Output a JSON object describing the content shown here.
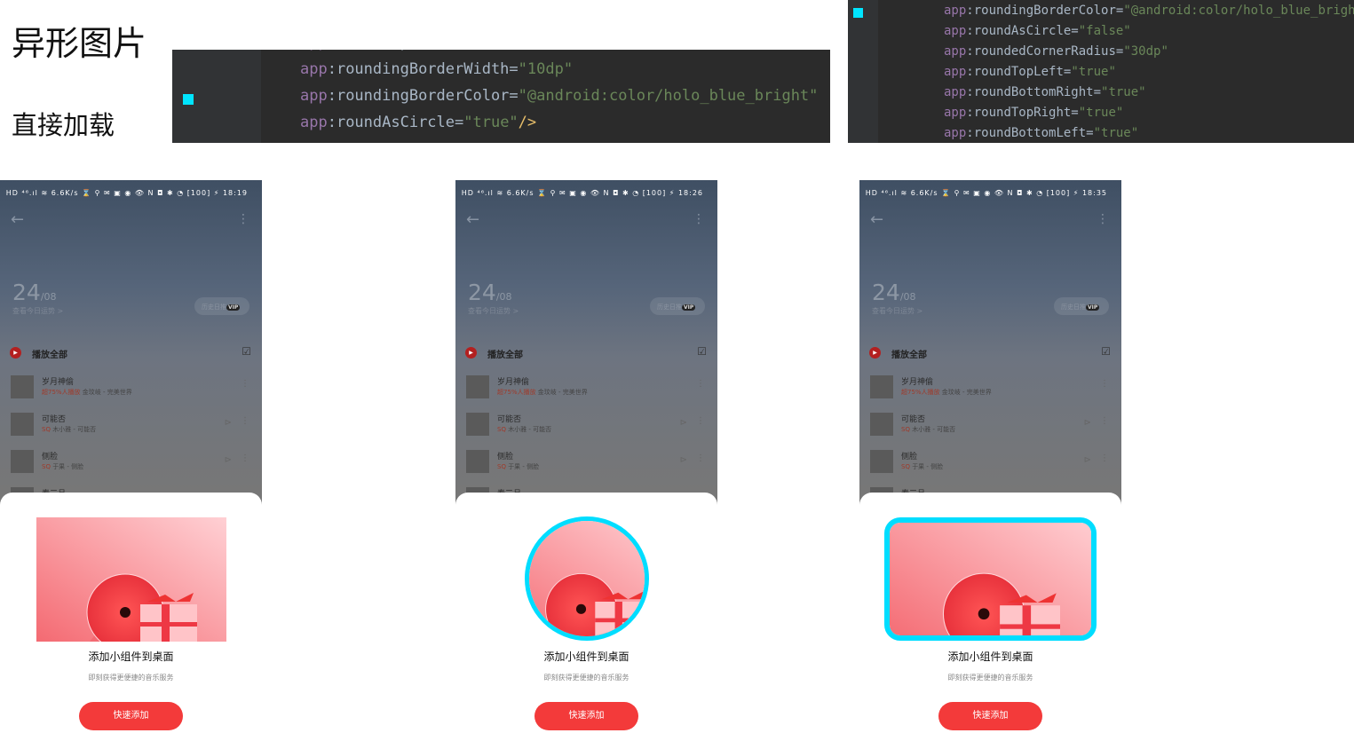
{
  "headings": {
    "title": "异形图片",
    "subtitle": "直接加载"
  },
  "code_left": {
    "lines": [
      {
        "k": "app",
        "a": ":roundTopLeft=",
        "v": "\"true\""
      },
      {
        "k": "app",
        "a": ":roundingBorderWidth=",
        "v": "\"10dp\""
      },
      {
        "k": "app",
        "a": ":roundingBorderColor=",
        "v": "\"@android:color/holo_blue_bright\""
      },
      {
        "k": "app",
        "a": ":roundAsCircle=",
        "v": "\"true\"",
        "end": "/>"
      }
    ]
  },
  "code_right": {
    "lines": [
      {
        "k": "app",
        "a": ":roundingBorderColor=",
        "v": "\"@android:color/holo_blue_bright\""
      },
      {
        "k": "app",
        "a": ":roundAsCircle=",
        "v": "\"false\""
      },
      {
        "k": "app",
        "a": ":roundedCornerRadius=",
        "v": "\"30dp\""
      },
      {
        "k": "app",
        "a": ":roundTopLeft=",
        "v": "\"true\""
      },
      {
        "k": "app",
        "a": ":roundBottomRight=",
        "v": "\"true\""
      },
      {
        "k": "app",
        "a": ":roundTopRight=",
        "v": "\"true\""
      },
      {
        "k": "app",
        "a": ":roundBottomLeft=",
        "v": "\"true\""
      }
    ]
  },
  "colors": {
    "border": "#00ddff",
    "button": "#f33a3a",
    "editor_bg": "#2b2b2b"
  },
  "phones": [
    {
      "time": "18:19",
      "shape": "rect"
    },
    {
      "time": "18:26",
      "shape": "circle"
    },
    {
      "time": "18:35",
      "shape": "rounded"
    }
  ],
  "phone": {
    "status_icons": "HD ⁴⁶.ıl ≋ 6.6K/s ⌛ ⚲ ✉ ▣ ◉  👁 N ◘ ✱ ◔ [100] ⚡",
    "date_day": "24",
    "date_month": "/08",
    "fortune": "查看今日运势 >",
    "history": "历史日推",
    "vip": "VIP",
    "play_all": "播放全部",
    "songs": [
      {
        "title": "岁月神偷",
        "tag": "超75%人播放",
        "sub": "金玟岐 - 完美世界"
      },
      {
        "title": "可能否",
        "tag": "SQ",
        "sub": "木小雅 - 可能否"
      },
      {
        "title": "侧脸",
        "tag": "SQ",
        "sub": "于果 - 侧脸"
      },
      {
        "title": "春三月",
        "tag": "",
        "sub": ""
      }
    ],
    "widget_title": "添加小组件到桌面",
    "widget_sub": "即刻获得更便捷的音乐服务",
    "add_button": "快速添加"
  }
}
